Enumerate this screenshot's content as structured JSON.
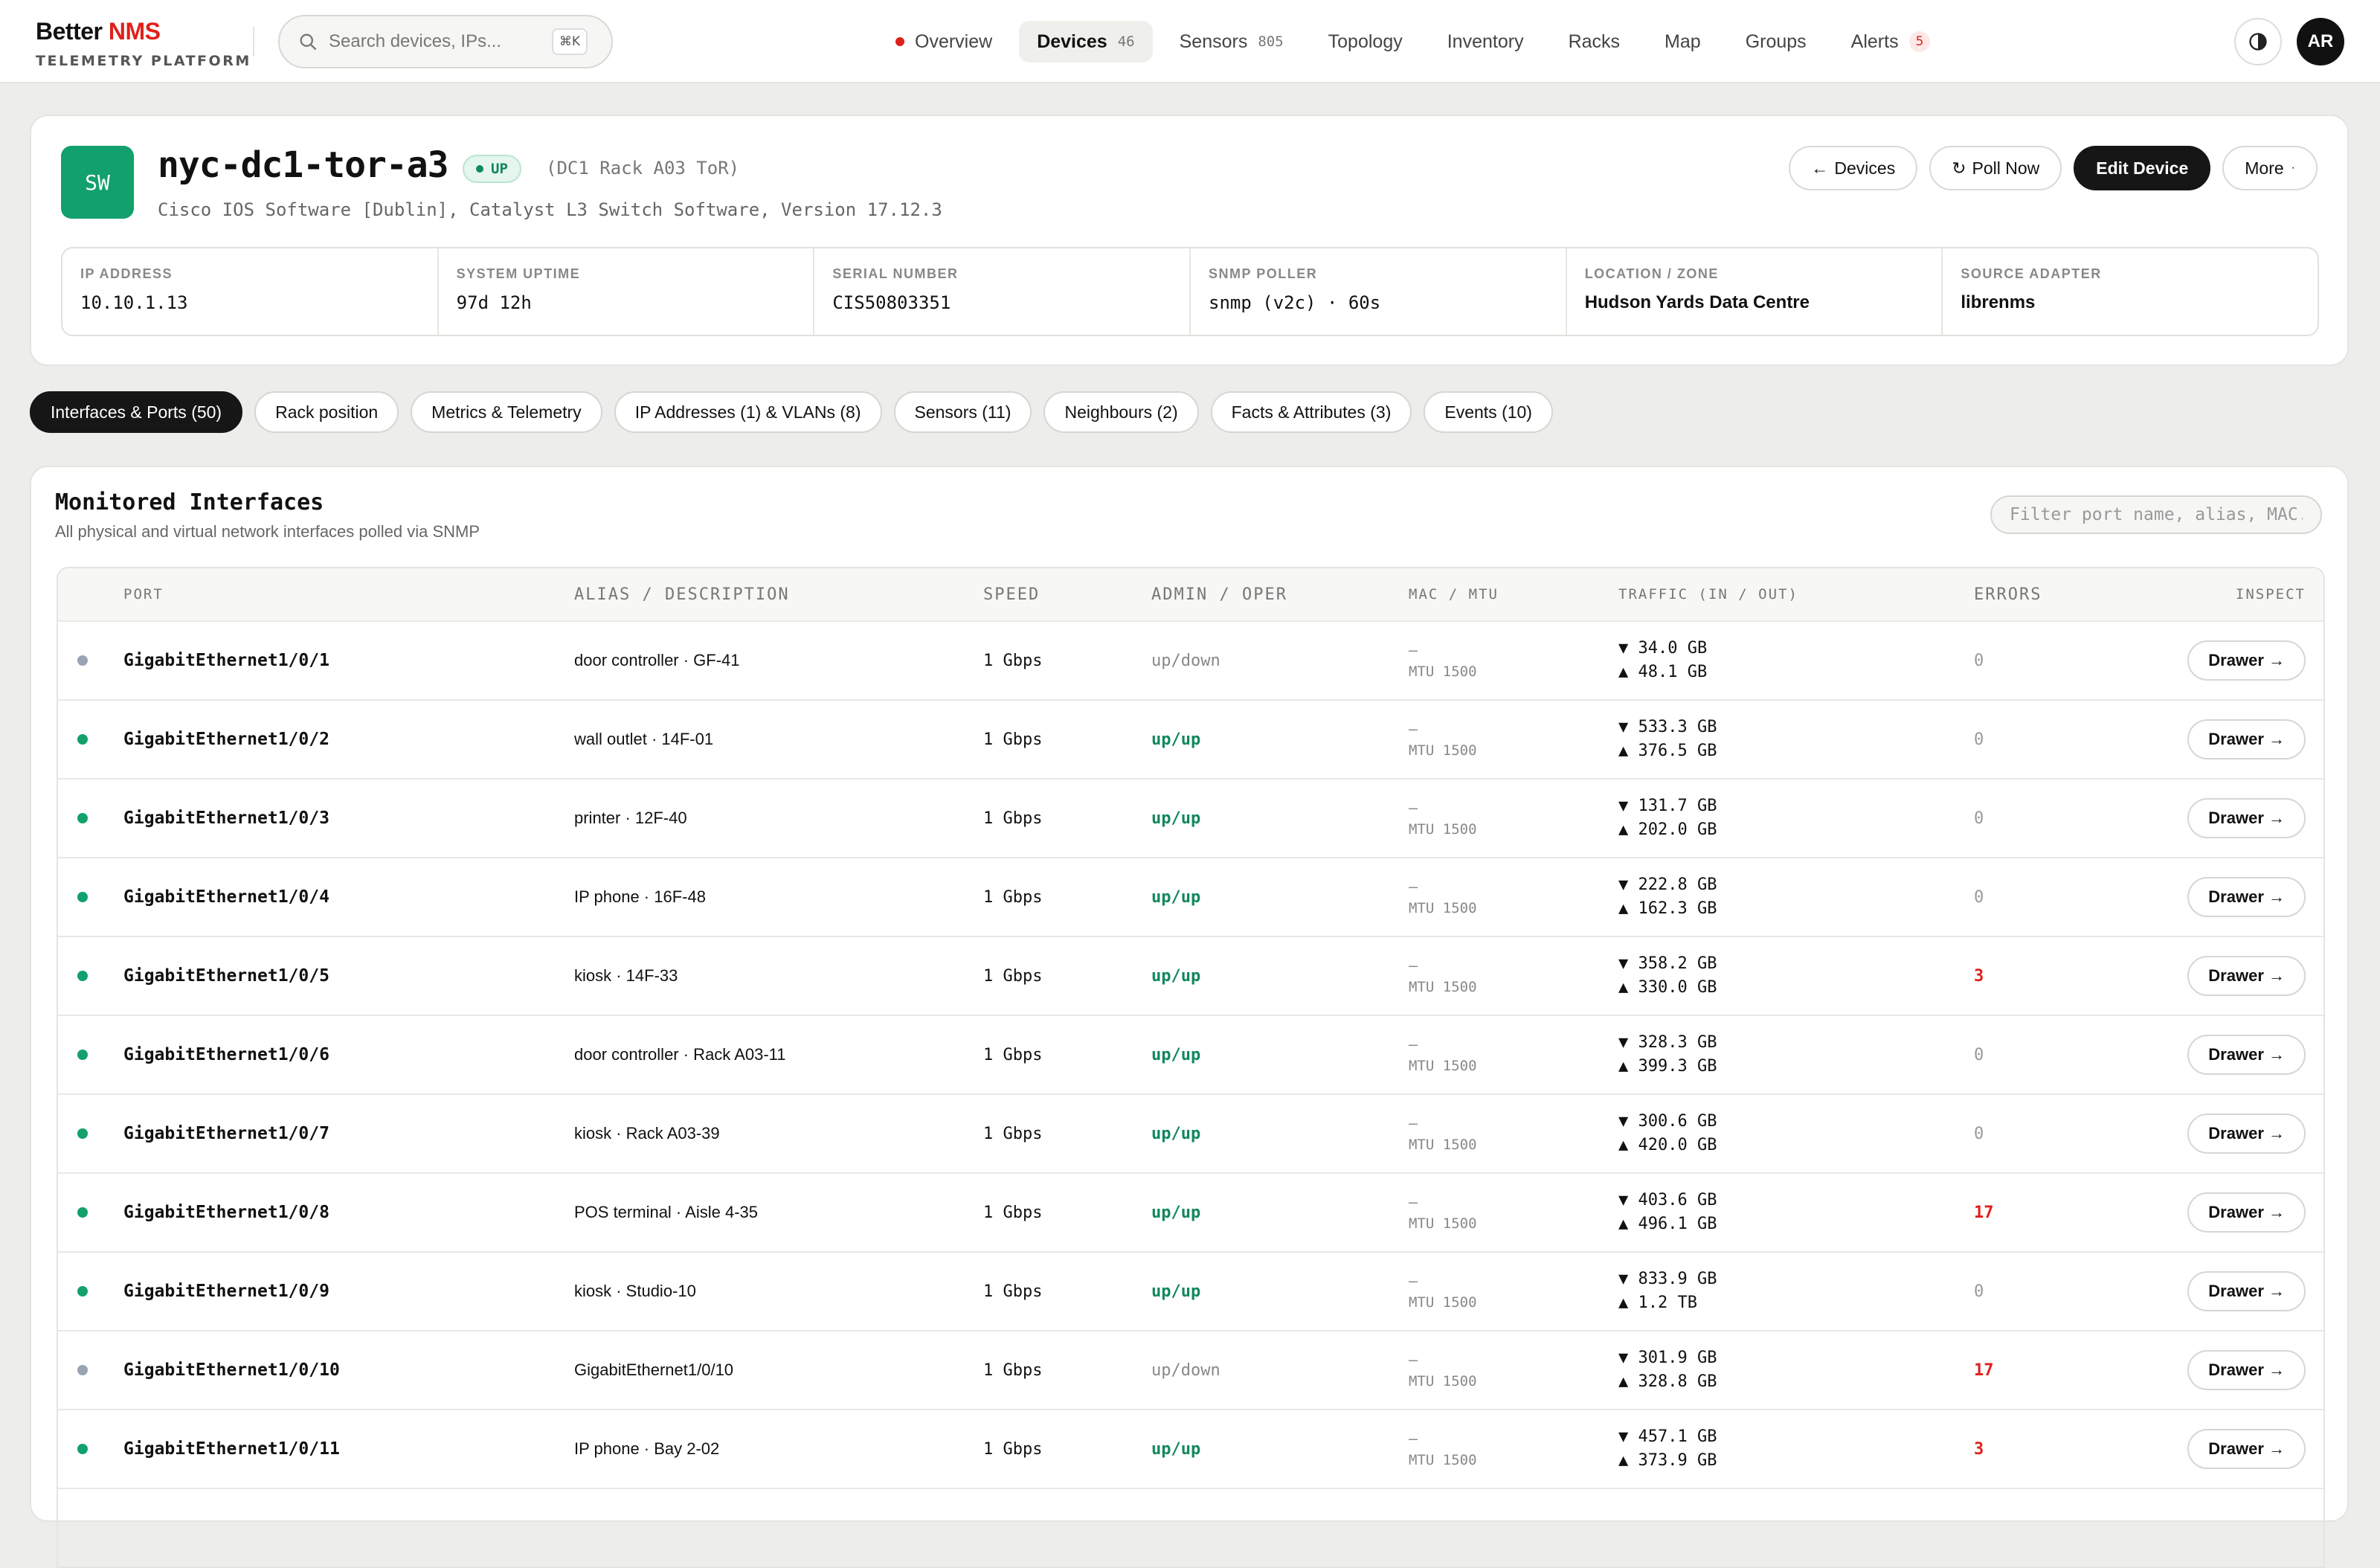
{
  "header": {
    "brand_main": "Better",
    "brand_accent": "NMS",
    "brand_sub": "TELEMETRY PLATFORM",
    "search_placeholder": "Search devices, IPs...",
    "search_shortcut": "⌘K",
    "nav": [
      {
        "label": "Overview",
        "count": "",
        "badge": "",
        "active": false,
        "dot": true
      },
      {
        "label": "Devices",
        "count": "46",
        "badge": "",
        "active": true,
        "dot": false
      },
      {
        "label": "Sensors",
        "count": "805",
        "badge": "",
        "active": false,
        "dot": false
      },
      {
        "label": "Topology",
        "count": "",
        "badge": "",
        "active": false,
        "dot": false
      },
      {
        "label": "Inventory",
        "count": "",
        "badge": "",
        "active": false,
        "dot": false
      },
      {
        "label": "Racks",
        "count": "",
        "badge": "",
        "active": false,
        "dot": false
      },
      {
        "label": "Map",
        "count": "",
        "badge": "",
        "active": false,
        "dot": false
      },
      {
        "label": "Groups",
        "count": "",
        "badge": "",
        "active": false,
        "dot": false
      },
      {
        "label": "Alerts",
        "count": "",
        "badge": "5",
        "active": false,
        "dot": false
      }
    ],
    "user_initials": "AR"
  },
  "device": {
    "type_abbr": "SW",
    "name": "nyc-dc1-tor-a3",
    "status": "UP",
    "alias": "(DC1 Rack A03 ToR)",
    "os": "Cisco IOS Software [Dublin], Catalyst L3 Switch Software, Version 17.12.3",
    "actions": {
      "back_label": "Devices",
      "poll_label": "Poll Now",
      "edit_label": "Edit Device",
      "more_label": "More"
    },
    "facts": [
      {
        "label": "IP ADDRESS",
        "value": "10.10.1.13",
        "style": "mono"
      },
      {
        "label": "SYSTEM UPTIME",
        "value": "97d 12h",
        "style": "mono"
      },
      {
        "label": "SERIAL NUMBER",
        "value": "CIS50803351",
        "style": "mono"
      },
      {
        "label": "SNMP POLLER",
        "value": "snmp (v2c) · 60s",
        "style": "mono"
      },
      {
        "label": "LOCATION / ZONE",
        "value": "Hudson Yards Data Centre",
        "style": "bold"
      },
      {
        "label": "SOURCE ADAPTER",
        "value": "librenms",
        "style": "bold"
      }
    ]
  },
  "tabs": [
    {
      "label": "Interfaces & Ports (50)",
      "active": true
    },
    {
      "label": "Rack position",
      "active": false
    },
    {
      "label": "Metrics & Telemetry",
      "active": false
    },
    {
      "label": "IP Addresses (1) & VLANs (8)",
      "active": false
    },
    {
      "label": "Sensors (11)",
      "active": false
    },
    {
      "label": "Neighbours (2)",
      "active": false
    },
    {
      "label": "Facts & Attributes (3)",
      "active": false
    },
    {
      "label": "Events (10)",
      "active": false
    }
  ],
  "interfaces": {
    "title": "Monitored Interfaces",
    "subtitle": "All physical and virtual network interfaces polled via SNMP",
    "filter_placeholder": "Filter port name, alias, MAC...",
    "columns": {
      "port": "PORT",
      "alias": "ALIAS / DESCRIPTION",
      "speed": "SPEED",
      "admin": "ADMIN / OPER",
      "mac": "MAC / MTU",
      "traffic": "TRAFFIC (IN / OUT)",
      "errors": "ERRORS",
      "inspect": "INSPECT"
    },
    "drawer_label": "Drawer →",
    "colors": {
      "up": "#12a06c",
      "down": "#9aa3b2"
    },
    "rows": [
      {
        "port": "GigabitEthernet1/0/1",
        "alias": "door controller · GF-41",
        "speed": "1 Gbps",
        "state": "up/down",
        "oper": "down",
        "mac": "—",
        "mtu": "MTU 1500",
        "in": "▼ 34.0 GB",
        "out": "▲ 48.1 GB",
        "errors": "0"
      },
      {
        "port": "GigabitEthernet1/0/2",
        "alias": "wall outlet · 14F-01",
        "speed": "1 Gbps",
        "state": "up/up",
        "oper": "up",
        "mac": "—",
        "mtu": "MTU 1500",
        "in": "▼ 533.3 GB",
        "out": "▲ 376.5 GB",
        "errors": "0"
      },
      {
        "port": "GigabitEthernet1/0/3",
        "alias": "printer · 12F-40",
        "speed": "1 Gbps",
        "state": "up/up",
        "oper": "up",
        "mac": "—",
        "mtu": "MTU 1500",
        "in": "▼ 131.7 GB",
        "out": "▲ 202.0 GB",
        "errors": "0"
      },
      {
        "port": "GigabitEthernet1/0/4",
        "alias": "IP phone · 16F-48",
        "speed": "1 Gbps",
        "state": "up/up",
        "oper": "up",
        "mac": "—",
        "mtu": "MTU 1500",
        "in": "▼ 222.8 GB",
        "out": "▲ 162.3 GB",
        "errors": "0"
      },
      {
        "port": "GigabitEthernet1/0/5",
        "alias": "kiosk · 14F-33",
        "speed": "1 Gbps",
        "state": "up/up",
        "oper": "up",
        "mac": "—",
        "mtu": "MTU 1500",
        "in": "▼ 358.2 GB",
        "out": "▲ 330.0 GB",
        "errors": "3"
      },
      {
        "port": "GigabitEthernet1/0/6",
        "alias": "door controller · Rack A03-11",
        "speed": "1 Gbps",
        "state": "up/up",
        "oper": "up",
        "mac": "—",
        "mtu": "MTU 1500",
        "in": "▼ 328.3 GB",
        "out": "▲ 399.3 GB",
        "errors": "0"
      },
      {
        "port": "GigabitEthernet1/0/7",
        "alias": "kiosk · Rack A03-39",
        "speed": "1 Gbps",
        "state": "up/up",
        "oper": "up",
        "mac": "—",
        "mtu": "MTU 1500",
        "in": "▼ 300.6 GB",
        "out": "▲ 420.0 GB",
        "errors": "0"
      },
      {
        "port": "GigabitEthernet1/0/8",
        "alias": "POS terminal · Aisle 4-35",
        "speed": "1 Gbps",
        "state": "up/up",
        "oper": "up",
        "mac": "—",
        "mtu": "MTU 1500",
        "in": "▼ 403.6 GB",
        "out": "▲ 496.1 GB",
        "errors": "17"
      },
      {
        "port": "GigabitEthernet1/0/9",
        "alias": "kiosk · Studio-10",
        "speed": "1 Gbps",
        "state": "up/up",
        "oper": "up",
        "mac": "—",
        "mtu": "MTU 1500",
        "in": "▼ 833.9 GB",
        "out": "▲ 1.2 TB",
        "errors": "0"
      },
      {
        "port": "GigabitEthernet1/0/10",
        "alias": "GigabitEthernet1/0/10",
        "speed": "1 Gbps",
        "state": "up/down",
        "oper": "down",
        "mac": "—",
        "mtu": "MTU 1500",
        "in": "▼ 301.9 GB",
        "out": "▲ 328.8 GB",
        "errors": "17"
      },
      {
        "port": "GigabitEthernet1/0/11",
        "alias": "IP phone · Bay 2-02",
        "speed": "1 Gbps",
        "state": "up/up",
        "oper": "up",
        "mac": "—",
        "mtu": "MTU 1500",
        "in": "▼ 457.1 GB",
        "out": "▲ 373.9 GB",
        "errors": "3"
      },
      {
        "port": "",
        "alias": "",
        "speed": "",
        "state": "",
        "oper": "up",
        "mac": "",
        "mtu": "",
        "in": "",
        "out": "",
        "errors": ""
      }
    ]
  }
}
